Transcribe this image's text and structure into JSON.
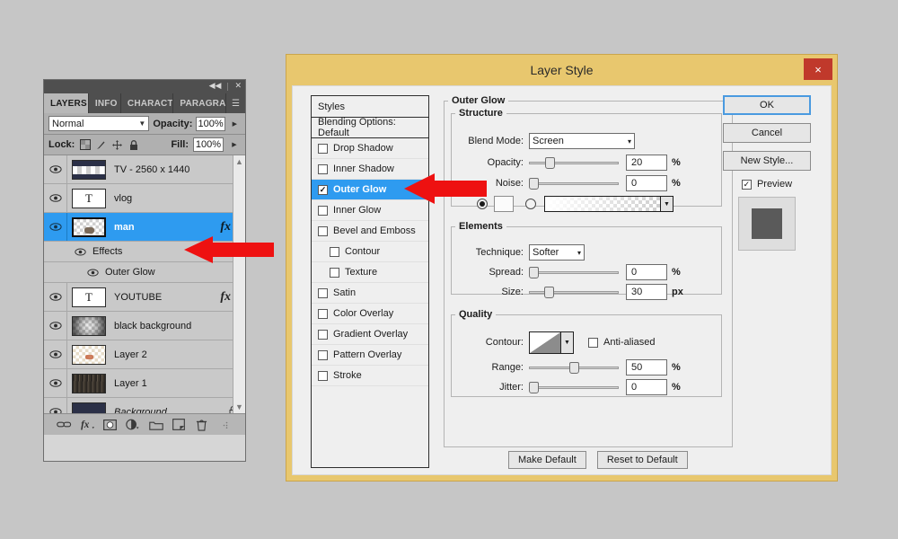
{
  "layers_panel": {
    "tabs": [
      {
        "label": "LAYERS",
        "active": true
      },
      {
        "label": "INFO",
        "active": false
      },
      {
        "label": "CHARACT",
        "active": false
      },
      {
        "label": "PARAGRA",
        "active": false
      }
    ],
    "blend_mode": "Normal",
    "opacity_label": "Opacity:",
    "opacity_value": "100%",
    "lock_label": "Lock:",
    "fill_label": "Fill:",
    "fill_value": "100%",
    "rows": [
      {
        "name": "TV - 2560 x 1440",
        "type": "image",
        "fx": false,
        "locked": false
      },
      {
        "name": "vlog",
        "type": "text",
        "fx": false,
        "locked": false
      },
      {
        "name": "man",
        "type": "transparent",
        "fx": true,
        "selected": true,
        "locked": false
      }
    ],
    "effects_label": "Effects",
    "effect_name": "Outer Glow",
    "rows_lower": [
      {
        "name": "YOUTUBE",
        "type": "text",
        "fx": true,
        "locked": false
      },
      {
        "name": "black background",
        "type": "checker-dark",
        "fx": false,
        "locked": false
      },
      {
        "name": "Layer 2",
        "type": "checker-light",
        "fx": false,
        "locked": false
      },
      {
        "name": "Layer 1",
        "type": "texture",
        "fx": false,
        "locked": false
      },
      {
        "name": "Background",
        "type": "solid-dark",
        "fx": false,
        "locked": true,
        "italic": true
      }
    ],
    "bottom_icons": [
      "link-icon",
      "fx-icon",
      "layer-mask-icon",
      "adjustment-layer-icon",
      "new-group-icon",
      "new-layer-icon",
      "delete-layer-icon"
    ]
  },
  "dialog": {
    "title": "Layer Style",
    "close_label": "×",
    "styles": {
      "header": "Styles",
      "blending_options": "Blending Options: Default",
      "items": [
        {
          "label": "Drop Shadow",
          "checked": false,
          "indent": false
        },
        {
          "label": "Inner Shadow",
          "checked": false,
          "indent": false
        },
        {
          "label": "Outer Glow",
          "checked": true,
          "indent": false,
          "selected": true
        },
        {
          "label": "Inner Glow",
          "checked": false,
          "indent": false
        },
        {
          "label": "Bevel and Emboss",
          "checked": false,
          "indent": false
        },
        {
          "label": "Contour",
          "checked": false,
          "indent": true
        },
        {
          "label": "Texture",
          "checked": false,
          "indent": true
        },
        {
          "label": "Satin",
          "checked": false,
          "indent": false
        },
        {
          "label": "Color Overlay",
          "checked": false,
          "indent": false
        },
        {
          "label": "Gradient Overlay",
          "checked": false,
          "indent": false
        },
        {
          "label": "Pattern Overlay",
          "checked": false,
          "indent": false
        },
        {
          "label": "Stroke",
          "checked": false,
          "indent": false
        }
      ]
    },
    "panel": {
      "title": "Outer Glow",
      "structure": {
        "legend": "Structure",
        "blend_mode_label": "Blend Mode:",
        "blend_mode_value": "Screen",
        "opacity_label": "Opacity:",
        "opacity_value": "20",
        "opacity_unit": "%",
        "noise_label": "Noise:",
        "noise_value": "0",
        "noise_unit": "%"
      },
      "elements": {
        "legend": "Elements",
        "technique_label": "Technique:",
        "technique_value": "Softer",
        "spread_label": "Spread:",
        "spread_value": "0",
        "spread_unit": "%",
        "size_label": "Size:",
        "size_value": "30",
        "size_unit": "px"
      },
      "quality": {
        "legend": "Quality",
        "contour_label": "Contour:",
        "antialiased_label": "Anti-aliased",
        "antialiased_checked": false,
        "range_label": "Range:",
        "range_value": "50",
        "range_unit": "%",
        "jitter_label": "Jitter:",
        "jitter_value": "0",
        "jitter_unit": "%"
      }
    },
    "buttons": {
      "ok": "OK",
      "cancel": "Cancel",
      "new_style": "New Style...",
      "preview": "Preview",
      "preview_checked": true,
      "make_default": "Make Default",
      "reset_to_default": "Reset to Default"
    }
  },
  "annotations": {
    "arrow_color": "#ee1111",
    "arrows": [
      {
        "name": "arrow-pointing-outer-glow-style",
        "target": "Outer Glow style row"
      },
      {
        "name": "arrow-pointing-outer-glow-layer-effect",
        "target": "Outer Glow layer effect"
      }
    ]
  },
  "colors": {
    "accent_selection": "#2e9bf0",
    "dialog_border": "#e8c76e",
    "close_button": "#c0392b",
    "page_background": "#c6c6c6"
  }
}
